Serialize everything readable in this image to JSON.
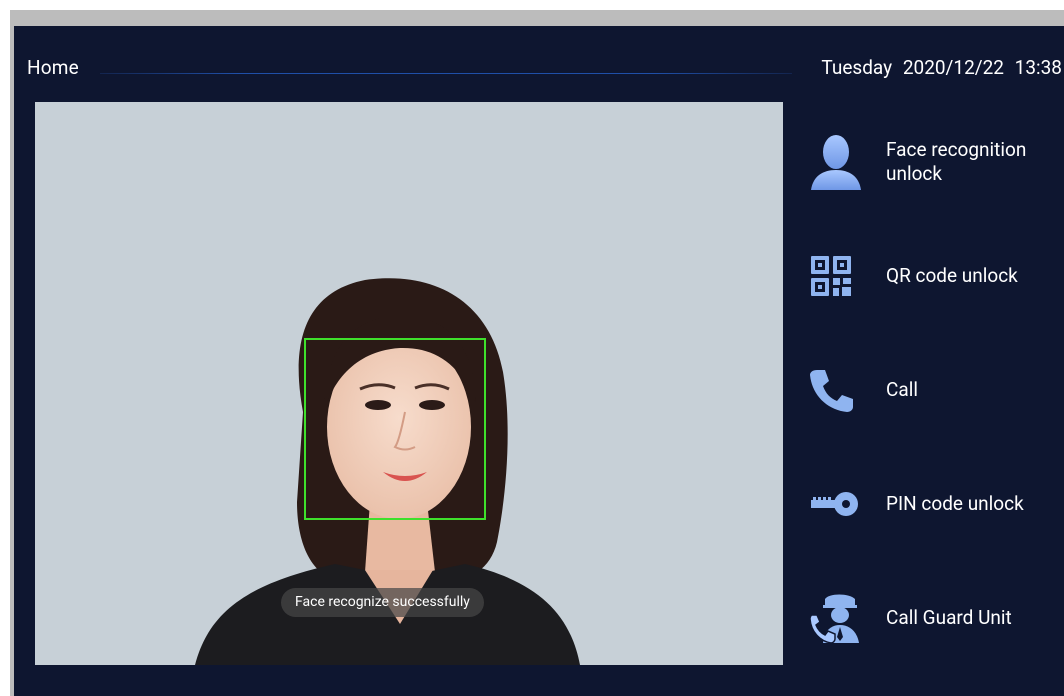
{
  "header": {
    "home_label": "Home",
    "weekday": "Tuesday",
    "date": "2020/12/22",
    "time": "13:38"
  },
  "camera": {
    "status_toast": "Face recognize successfully",
    "face_box_color": "#3fe02c"
  },
  "menu": {
    "items": [
      {
        "label": "Face recognition unlock",
        "icon": "person-silhouette-icon"
      },
      {
        "label": "QR code unlock",
        "icon": "qr-code-icon"
      },
      {
        "label": "Call",
        "icon": "phone-icon"
      },
      {
        "label": "PIN code unlock",
        "icon": "key-icon"
      },
      {
        "label": "Call Guard Unit",
        "icon": "guard-phone-icon"
      }
    ]
  },
  "colors": {
    "background": "#0e1630",
    "icon_blue": "#8fb4f0",
    "text": "#ffffff"
  }
}
